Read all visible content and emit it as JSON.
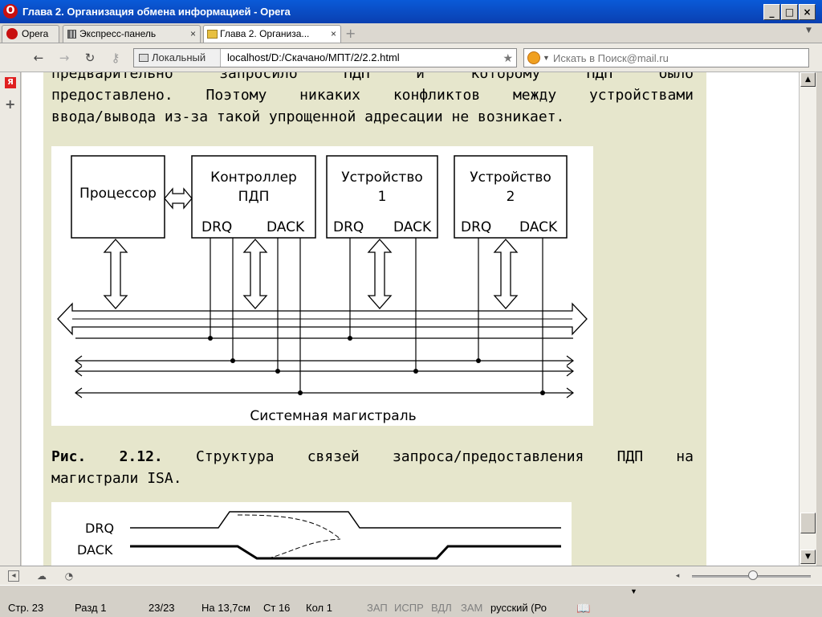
{
  "window": {
    "title": "Глава 2. Организация обмена информацией - Opera",
    "logo_letter": "O",
    "minimize": "_",
    "maximize": "□",
    "close": "×"
  },
  "tabs": [
    {
      "label": "Opera"
    },
    {
      "label": "Экспресс-панель"
    },
    {
      "label": "Глава 2. Организа..."
    }
  ],
  "tab_close": "×",
  "nav": {
    "back": "←",
    "forward": "→",
    "reload": "↻",
    "key": "⚷",
    "zone": "Локальный",
    "url": "localhost/D:/Скачано/МПТ/2/2.2.html",
    "bookmark": "★",
    "search_placeholder": "Искать в Поиск@mail.ru",
    "search_caret": "▼"
  },
  "left_panel": {
    "yandex": "Я",
    "add": "+"
  },
  "content": {
    "lines_top": [
      "предварительно   запросило   ПДП   и   которому   ПДП   было",
      "предоставлено. Поэтому никаких конфликтов между устройствами"
    ],
    "line_last": "ввода/вывода из-за такой упрощенной адресации не возникает.",
    "caption_bold": "Рис. 2.12.",
    "caption_line1": " Структура связей запроса/предоставления ПДП на",
    "caption_line2": "магистрали ISA.",
    "figure1": {
      "processor": "Процессор",
      "controller_l1": "Контроллер",
      "controller_l2": "ПДП",
      "device1_l1": "Устройство",
      "device1_l2": "1",
      "device2_l1": "Устройство",
      "device2_l2": "2",
      "drq": "DRQ",
      "dack": "DACK",
      "bus_label": "Системная магистраль"
    },
    "figure2": {
      "drq": "DRQ",
      "dack": "DACK"
    }
  },
  "scroll": {
    "up": "▲",
    "down": "▼"
  },
  "status": [
    {
      "label": "Стр. 23"
    },
    {
      "label": "Разд 1"
    },
    {
      "label": "23/23"
    },
    {
      "label": "На 13,7см"
    },
    {
      "label": "Ст 16"
    },
    {
      "label": "Кол 1"
    },
    {
      "label": "ЗАП",
      "dim": true
    },
    {
      "label": "ИСПР",
      "dim": true
    },
    {
      "label": "ВДЛ",
      "dim": true
    },
    {
      "label": "ЗАМ",
      "dim": true
    },
    {
      "label": "русский (Ро"
    }
  ]
}
